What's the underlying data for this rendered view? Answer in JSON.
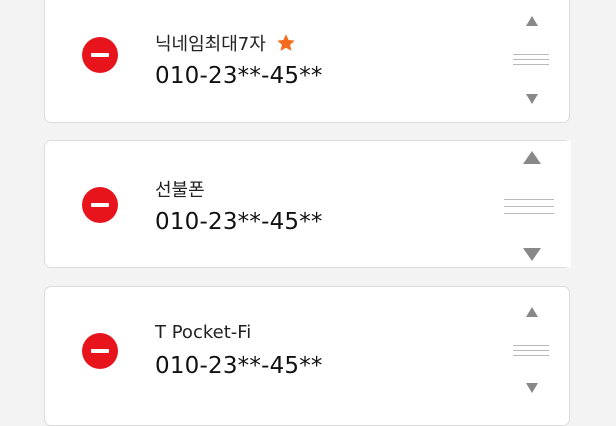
{
  "colors": {
    "remove": "#e8141c",
    "star": "#f26b1d",
    "background": "#f3f3f3",
    "card": "#ffffff"
  },
  "contacts": [
    {
      "nickname": "닉네임최대7자",
      "number": "010-23**-45**",
      "favorite": true,
      "icons": [
        "remove-icon",
        "star-icon",
        "move-up-icon",
        "drag-handle-icon",
        "move-down-icon"
      ]
    },
    {
      "nickname": "선불폰",
      "number": "010-23**-45**",
      "favorite": false,
      "icons": [
        "remove-icon",
        "move-up-icon",
        "drag-handle-icon",
        "move-down-icon"
      ]
    },
    {
      "nickname": "T Pocket-Fi",
      "number": "010-23**-45**",
      "favorite": false,
      "icons": [
        "remove-icon",
        "move-up-icon",
        "drag-handle-icon",
        "move-down-icon"
      ]
    }
  ]
}
